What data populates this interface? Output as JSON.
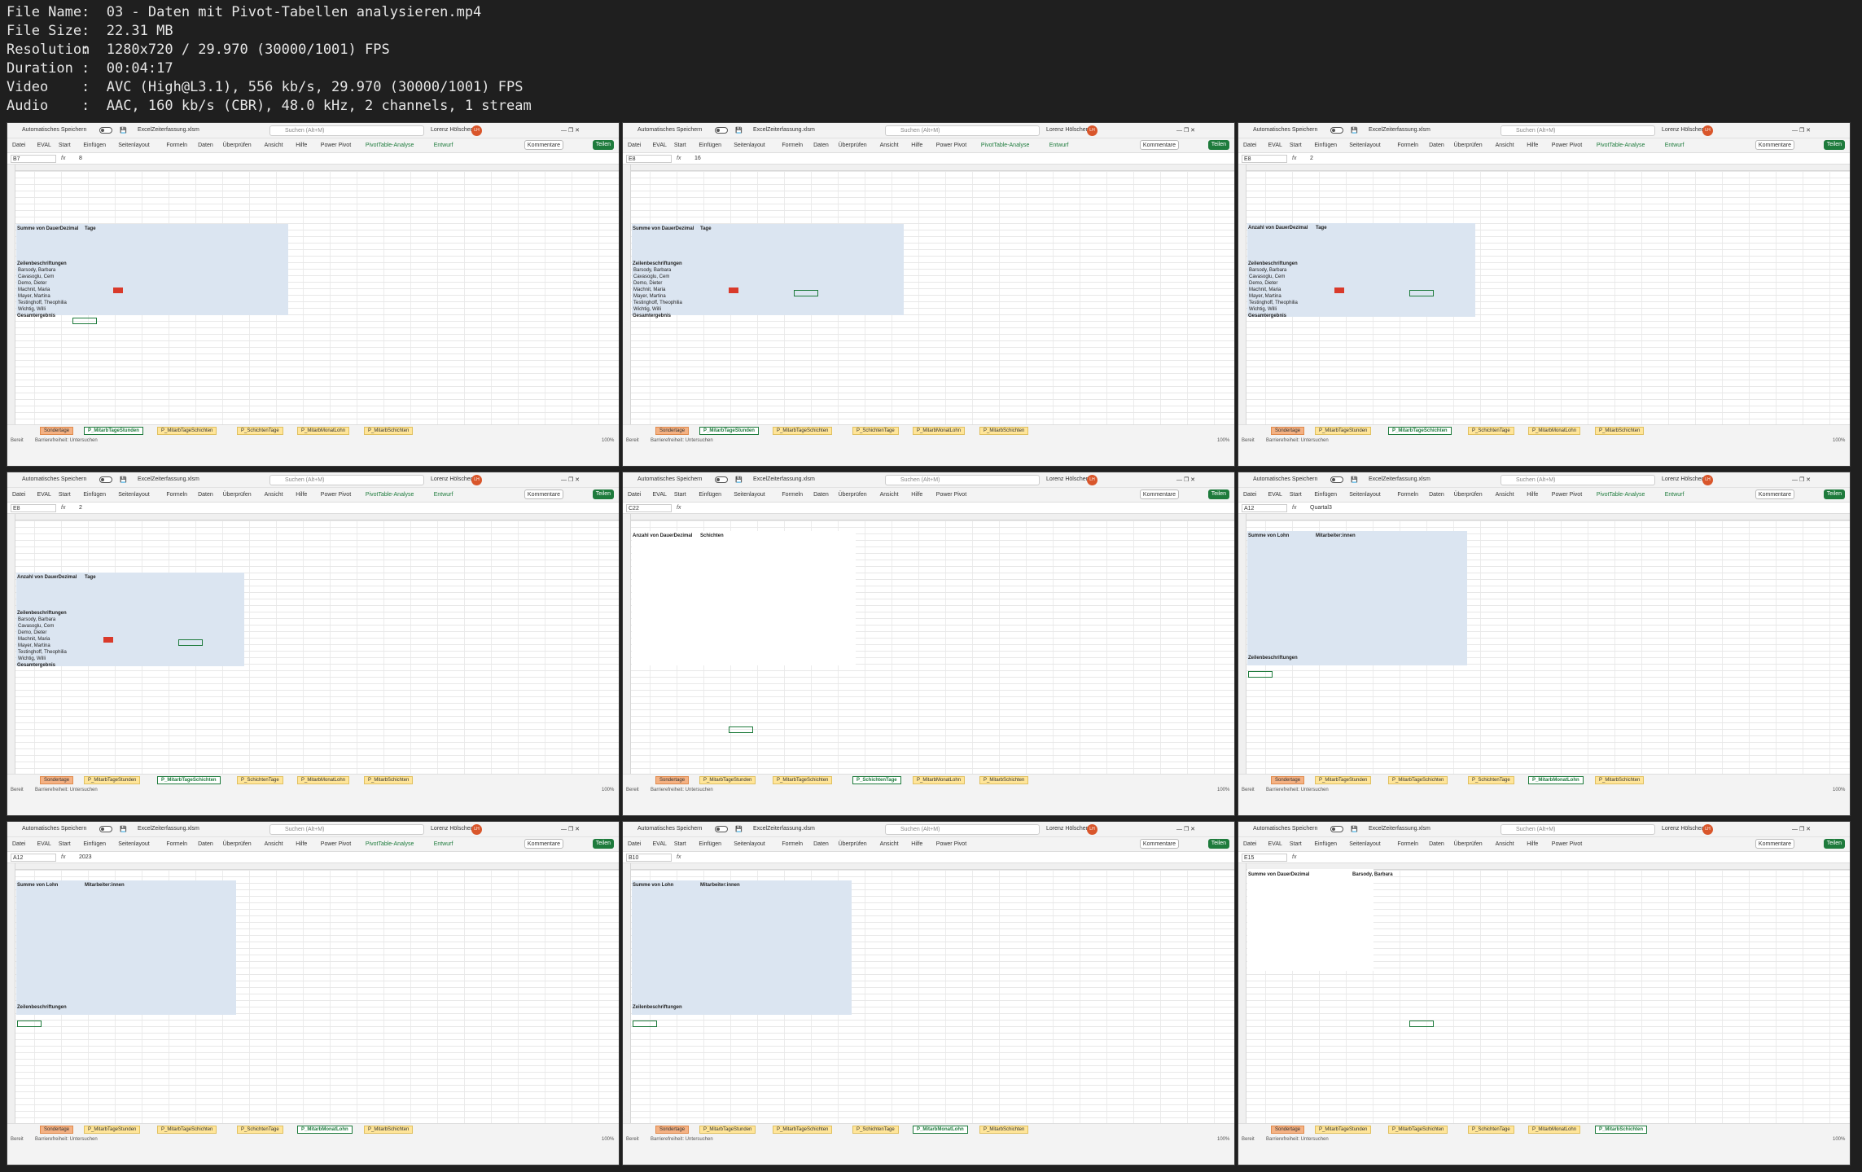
{
  "file_info": [
    {
      "key": "File Name",
      "value": "03 - Daten mit Pivot-Tabellen analysieren.mp4"
    },
    {
      "key": "File Size",
      "value": "22.31 MB"
    },
    {
      "key": "Resolution",
      "value": "1280x720 / 29.970 (30000/1001) FPS"
    },
    {
      "key": "Duration",
      "value": "00:04:17"
    },
    {
      "key": "Video",
      "value": "AVC (High@L3.1), 556 kb/s, 29.970 (30000/1001) FPS"
    },
    {
      "key": "Audio",
      "value": "AAC, 160 kb/s (CBR), 48.0 kHz, 2 channels, 1 stream"
    }
  ],
  "window": {
    "autosave": "Automatisches Speichern",
    "filename": "ExcelZeiterfassung.xlsm",
    "search": "Suchen (Alt+M)",
    "user": "Lorenz Hölscher",
    "avatar": "LH",
    "comments": "Kommentare",
    "share": "Teilen"
  },
  "menu": [
    "Datei",
    "EVAL",
    "Start",
    "Einfügen",
    "Seitenlayout",
    "Formeln",
    "Daten",
    "Überprüfen",
    "Ansicht",
    "Hilfe",
    "Power Pivot"
  ],
  "menu_pivot": [
    "PivotTable-Analyse",
    "Entwurf"
  ],
  "sheet_tabs": [
    "Sondertage",
    "P_MitarbTageStunden",
    "P_MitarbTageSchichten",
    "P_SchichtenTage",
    "P_MitarbMonatLohn",
    "P_MitarbSchichten"
  ],
  "status": {
    "ready": "Bereit",
    "access": "Barrierefreiheit: Untersuchen",
    "zoom": "100%"
  },
  "thumbs": [
    {
      "cell": "B7",
      "formula": "8",
      "pivot": "Summe von DauerDezimal",
      "col": "Tage",
      "active_tab": 1,
      "show_pivot_menu": true
    },
    {
      "cell": "E8",
      "formula": "16",
      "pivot": "Summe von DauerDezimal",
      "col": "Tage",
      "active_tab": 1,
      "show_pivot_menu": true
    },
    {
      "cell": "E8",
      "formula": "2",
      "pivot": "Anzahl von DauerDezimal",
      "col": "Tage",
      "active_tab": 2,
      "show_pivot_menu": true
    },
    {
      "cell": "E8",
      "formula": "2",
      "pivot": "Anzahl von DauerDezimal",
      "col": "Tage",
      "active_tab": 2,
      "show_pivot_menu": true
    },
    {
      "cell": "C22",
      "formula": "",
      "pivot": "Anzahl von DauerDezimal",
      "col": "Schichten",
      "active_tab": 3,
      "show_pivot_menu": false
    },
    {
      "cell": "A12",
      "formula": "Quartal3",
      "pivot": "Summe von Lohn",
      "col": "Mitarbeiter:innen",
      "active_tab": 4,
      "show_pivot_menu": true
    },
    {
      "cell": "A12",
      "formula": "2023",
      "pivot": "Summe von Lohn",
      "col": "Mitarbeiter:innen",
      "active_tab": 4,
      "show_pivot_menu": true
    },
    {
      "cell": "B10",
      "formula": "",
      "pivot": "Summe von Lohn",
      "col": "Mitarbeiter:innen",
      "active_tab": 4,
      "show_pivot_menu": false
    },
    {
      "cell": "E15",
      "formula": "",
      "pivot": "Summe von DauerDezimal",
      "col": "Barsody, Barbara",
      "active_tab": 5,
      "show_pivot_menu": false
    }
  ],
  "pivot_rows_label": "Zeilenbeschriftungen",
  "grand_total": "Gesamtergebnis",
  "names": [
    "Barsody, Barbara",
    "Cavasoglu, Cem",
    "Demo, Dieter",
    "Machnit, Maria",
    "Mayer, Martina",
    "Testinghoff, Theophilia",
    "Wichtig, Willi"
  ]
}
